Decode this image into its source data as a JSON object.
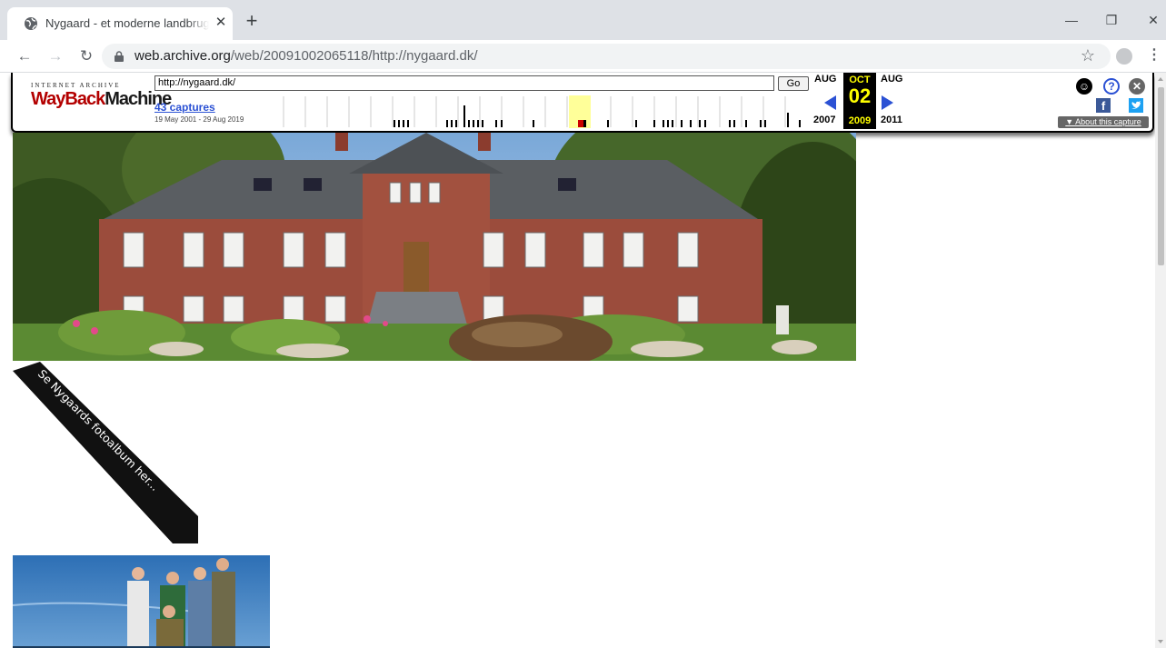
{
  "browser": {
    "tab_title": "Nygaard - et moderne landbrug",
    "url_host": "web.archive.org",
    "url_path": "/web/20091002065118/http://nygaard.dk/",
    "favicon": "globe-icon"
  },
  "wayback": {
    "logo_top": "INTERNET ARCHIVE",
    "logo_main_a": "WayBack",
    "logo_main_b": "Machine",
    "url_value": "http://nygaard.dk/",
    "go_label": "Go",
    "captures_label": "43 captures",
    "date_range": "19 May 2001 - 29 Aug 2019",
    "prev_month": "AUG",
    "prev_year": "2007",
    "current_month": "OCT",
    "current_day": "02",
    "current_year": "2009",
    "next_month": "AUG",
    "next_year": "2011",
    "about_label": "▼ About this capture",
    "colors": {
      "accent_blue": "#2b51d4",
      "highlight_yellow": "#ffff00",
      "logo_red": "#b30000"
    }
  },
  "page": {
    "ribbon_text": "Se Nygaards fotoalbum her...",
    "hero_description": "Red brick manor house with garden",
    "team_description": "Group photo of farm staff"
  }
}
